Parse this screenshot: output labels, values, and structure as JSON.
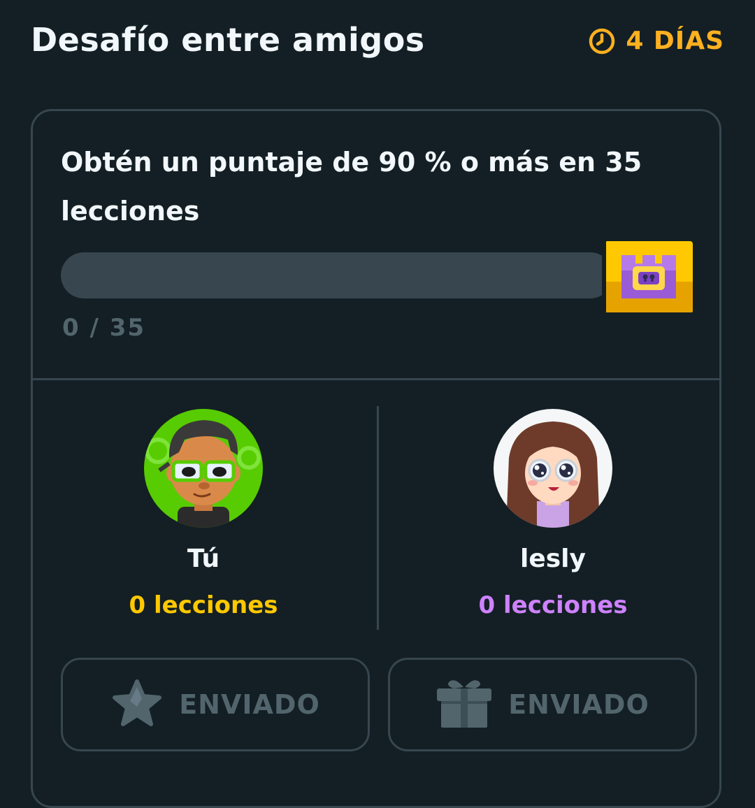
{
  "header": {
    "title": "Desafío entre amigos",
    "timer_label": "4 DÍAS",
    "timer_icon": "clock-icon",
    "accent_color": "#ffb020"
  },
  "challenge": {
    "goal": "Obtén un puntaje de 90 % o más en 35 lecciones",
    "progress_label": "0 / 35",
    "progress_value": 0,
    "progress_total": 35,
    "reward_icon": "treasure-chest-icon"
  },
  "players": [
    {
      "name": "Tú",
      "score": "0 lecciones",
      "color": "#ffc800",
      "avatar": "avatar-you"
    },
    {
      "name": "lesly",
      "score": "0 lecciones",
      "color": "#ce82ff",
      "avatar": "avatar-lesly"
    }
  ],
  "actions": [
    {
      "label": "ENVIADO",
      "icon": "star-icon"
    },
    {
      "label": "ENVIADO",
      "icon": "gift-icon"
    }
  ]
}
